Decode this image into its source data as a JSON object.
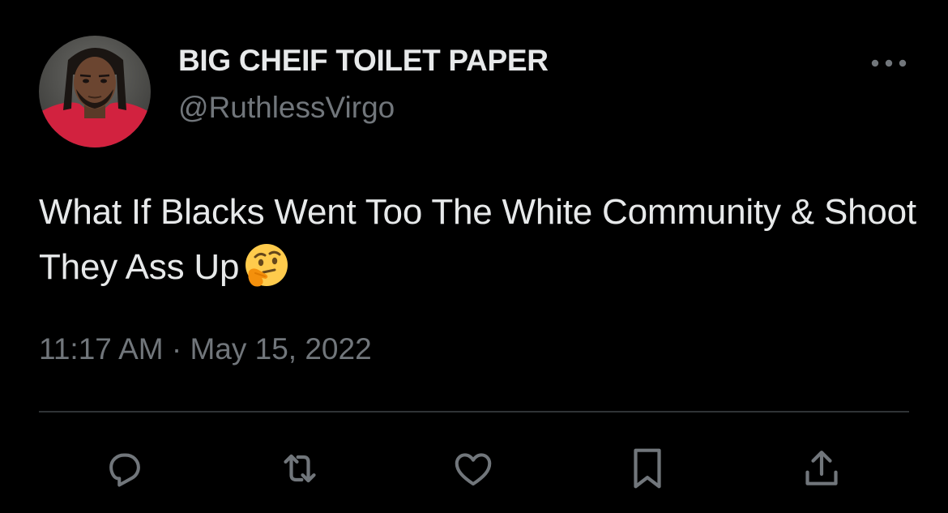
{
  "user": {
    "display_name": "BIG CHEIF TOILET PAPER",
    "handle": "@RuthlessVirgo",
    "avatar_icon": "profile-photo"
  },
  "tweet": {
    "text": "What If Blacks Went Too The White Community & Shoot They Ass Up",
    "emoji": "thinking-face-icon",
    "timestamp": "11:17 AM · May 15, 2022"
  },
  "actions": {
    "more": "more-options-icon",
    "reply": "reply-icon",
    "retweet": "retweet-icon",
    "like": "like-icon",
    "bookmark": "bookmark-icon",
    "share": "share-icon"
  },
  "colors": {
    "background": "#000000",
    "primary_text": "#e7e9ea",
    "secondary_text": "#71767b",
    "divider": "#2f3336"
  }
}
